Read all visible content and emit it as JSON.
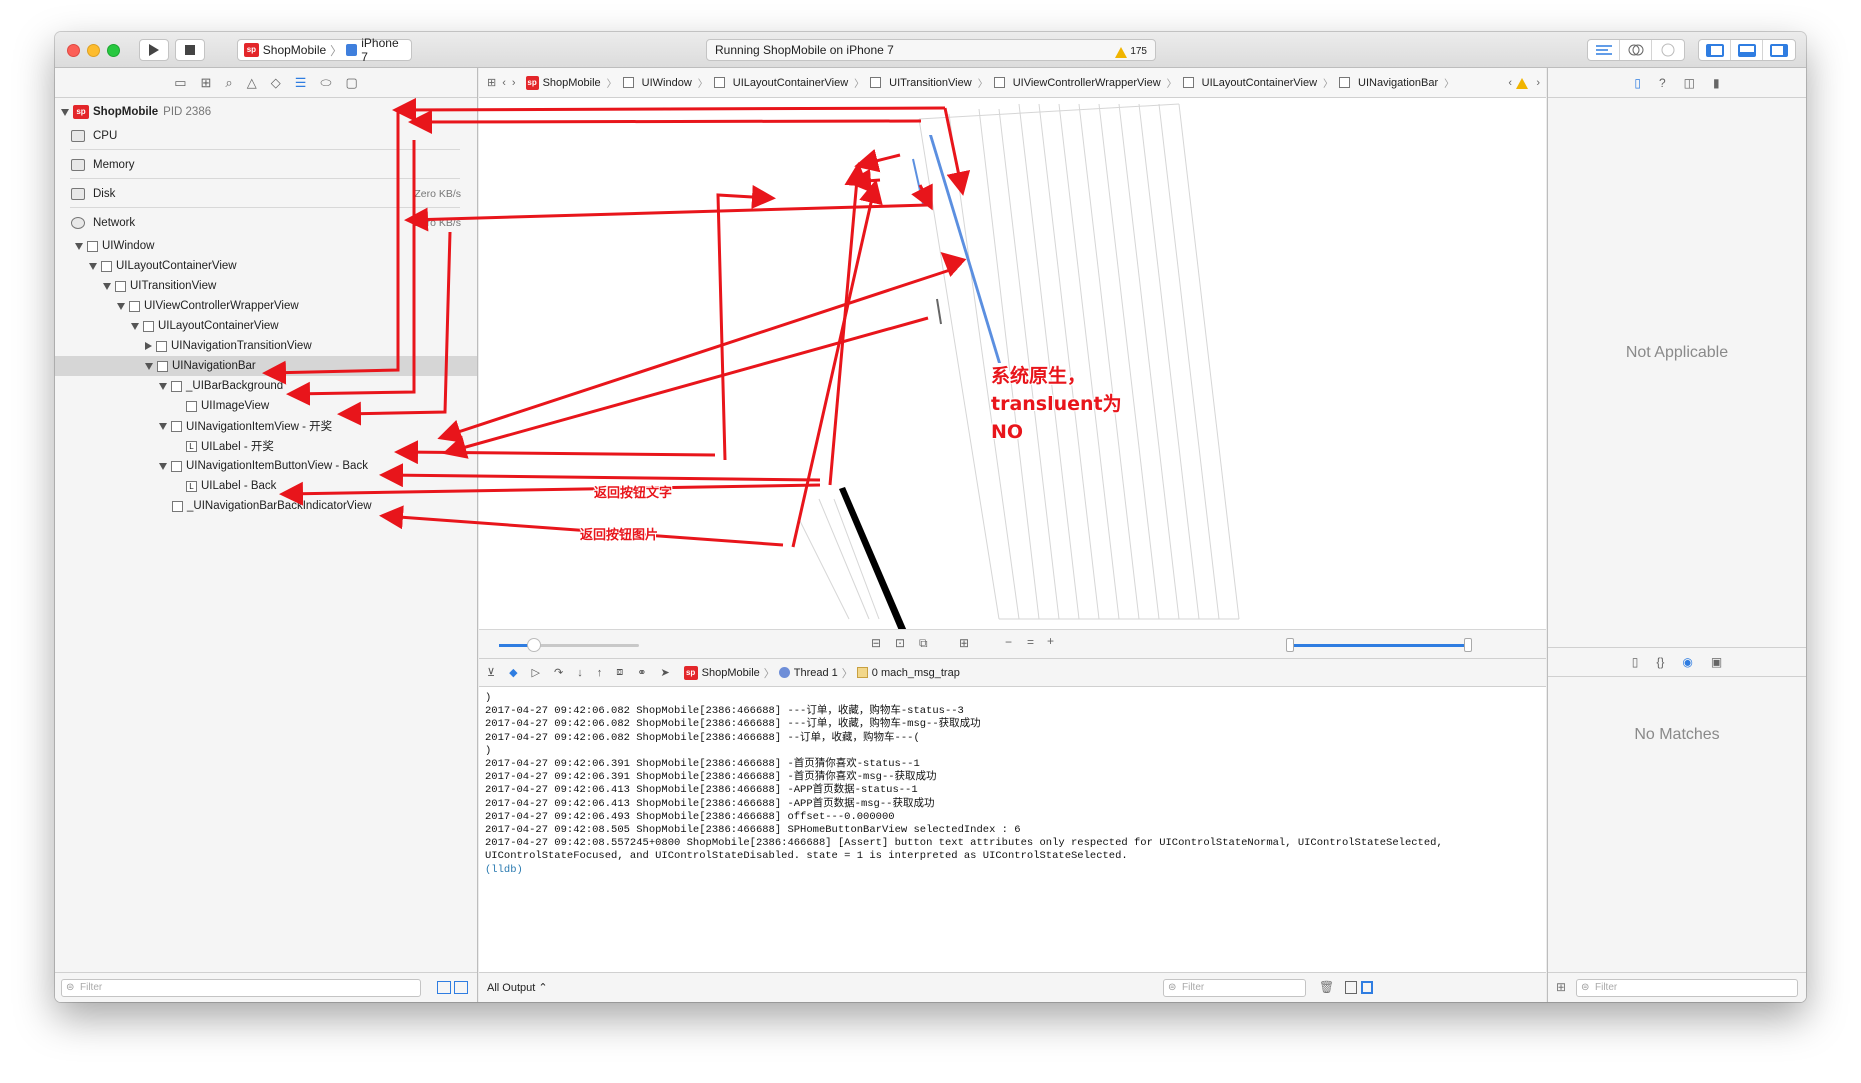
{
  "titlebar": {
    "scheme_app": "ShopMobile",
    "scheme_device": "iPhone 7",
    "activity_text": "Running ShopMobile on iPhone 7",
    "warning_count": "175"
  },
  "navigator": {
    "process_name": "ShopMobile",
    "process_pid": "PID 2386",
    "gauges": [
      {
        "label": "CPU",
        "value": ""
      },
      {
        "label": "Memory",
        "value": ""
      },
      {
        "label": "Disk",
        "value": "Zero KB/s"
      },
      {
        "label": "Network",
        "value": "Zero KB/s"
      }
    ],
    "tree": [
      "UIWindow",
      "UILayoutContainerView",
      "UITransitionView",
      "UIViewControllerWrapperView",
      "UILayoutContainerView",
      "UINavigationTransitionView",
      "UINavigationBar",
      "_UIBarBackground",
      "UIImageView",
      "UINavigationItemView - 开奖",
      "UILabel - 开奖",
      "UINavigationItemButtonView - Back",
      "UILabel - Back",
      "_UINavigationBarBackIndicatorView"
    ],
    "filter_placeholder": "Filter"
  },
  "jumpbar": {
    "crumbs": [
      "ShopMobile",
      "UIWindow",
      "UILayoutContainerView",
      "UITransitionView",
      "UIViewControllerWrapperView",
      "UILayoutContainerView",
      "UINavigationBar"
    ]
  },
  "debugbar": {
    "app": "ShopMobile",
    "thread": "Thread 1",
    "frame": "0 mach_msg_trap"
  },
  "console": {
    "lines": [
      ")",
      "2017-04-27 09:42:06.082 ShopMobile[2386:466688] ---订单，收藏，购物车-status--3",
      "2017-04-27 09:42:06.082 ShopMobile[2386:466688] ---订单，收藏，购物车-msg--获取成功",
      "2017-04-27 09:42:06.082 ShopMobile[2386:466688] --订单，收藏，购物车---(",
      ")",
      "2017-04-27 09:42:06.391 ShopMobile[2386:466688] -首页猜你喜欢-status--1",
      "2017-04-27 09:42:06.391 ShopMobile[2386:466688] -首页猜你喜欢-msg--获取成功",
      "2017-04-27 09:42:06.413 ShopMobile[2386:466688] -APP首页数据-status--1",
      "2017-04-27 09:42:06.413 ShopMobile[2386:466688] -APP首页数据-msg--获取成功",
      "2017-04-27 09:42:06.493 ShopMobile[2386:466688] offset---0.000000",
      "2017-04-27 09:42:08.505 ShopMobile[2386:466688] SPHomeButtonBarView selectedIndex : 6",
      "2017-04-27 09:42:08.557245+0800 ShopMobile[2386:466688] [Assert] button text attributes only respected for UIControlStateNormal, UIControlStateSelected,",
      "UIControlStateFocused, and UIControlStateDisabled. state = 1 is interpreted as UIControlStateSelected."
    ],
    "prompt": "(lldb)",
    "output_select": "All Output",
    "filter_placeholder": "Filter"
  },
  "inspector": {
    "top_placeholder": "Not Applicable",
    "bottom_placeholder": "No Matches",
    "filter_placeholder": "Filter"
  },
  "annotations": {
    "native_note": [
      "系统原生，",
      "transluent为",
      "NO"
    ],
    "back_text_note": "返回按钮文字",
    "back_image_note": "返回按钮图片"
  },
  "colors": {
    "annotation_red": "#e8151b",
    "selection_blue": "#2f7de1",
    "app_icon_red": "#e3262a"
  }
}
